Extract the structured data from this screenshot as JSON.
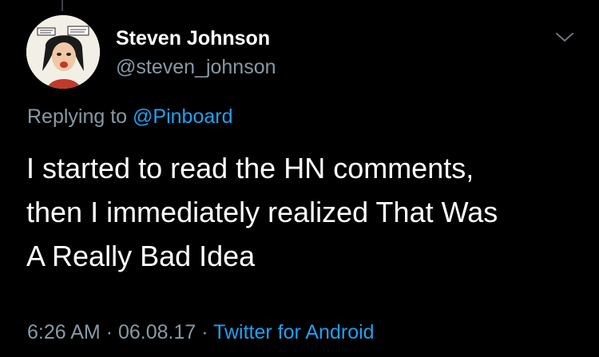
{
  "tweet": {
    "author": {
      "name": "Steven Johnson",
      "handle": "@steven_johnson",
      "avatar_icon": "comic-portrait-avatar"
    },
    "reply_prefix": "Replying to",
    "reply_to": "@Pinboard",
    "text_lines": [
      "I started to read the HN comments,",
      "then I immediately realized That Was",
      "A Really Bad Idea"
    ],
    "time": "6:26 AM",
    "date": "06.08.17",
    "separator": "·",
    "source": "Twitter for Android",
    "menu_icon": "chevron-down-icon"
  },
  "colors": {
    "background": "#000000",
    "primary_text": "#ffffff",
    "secondary_text": "#8899a6",
    "link": "#1da1f2"
  }
}
